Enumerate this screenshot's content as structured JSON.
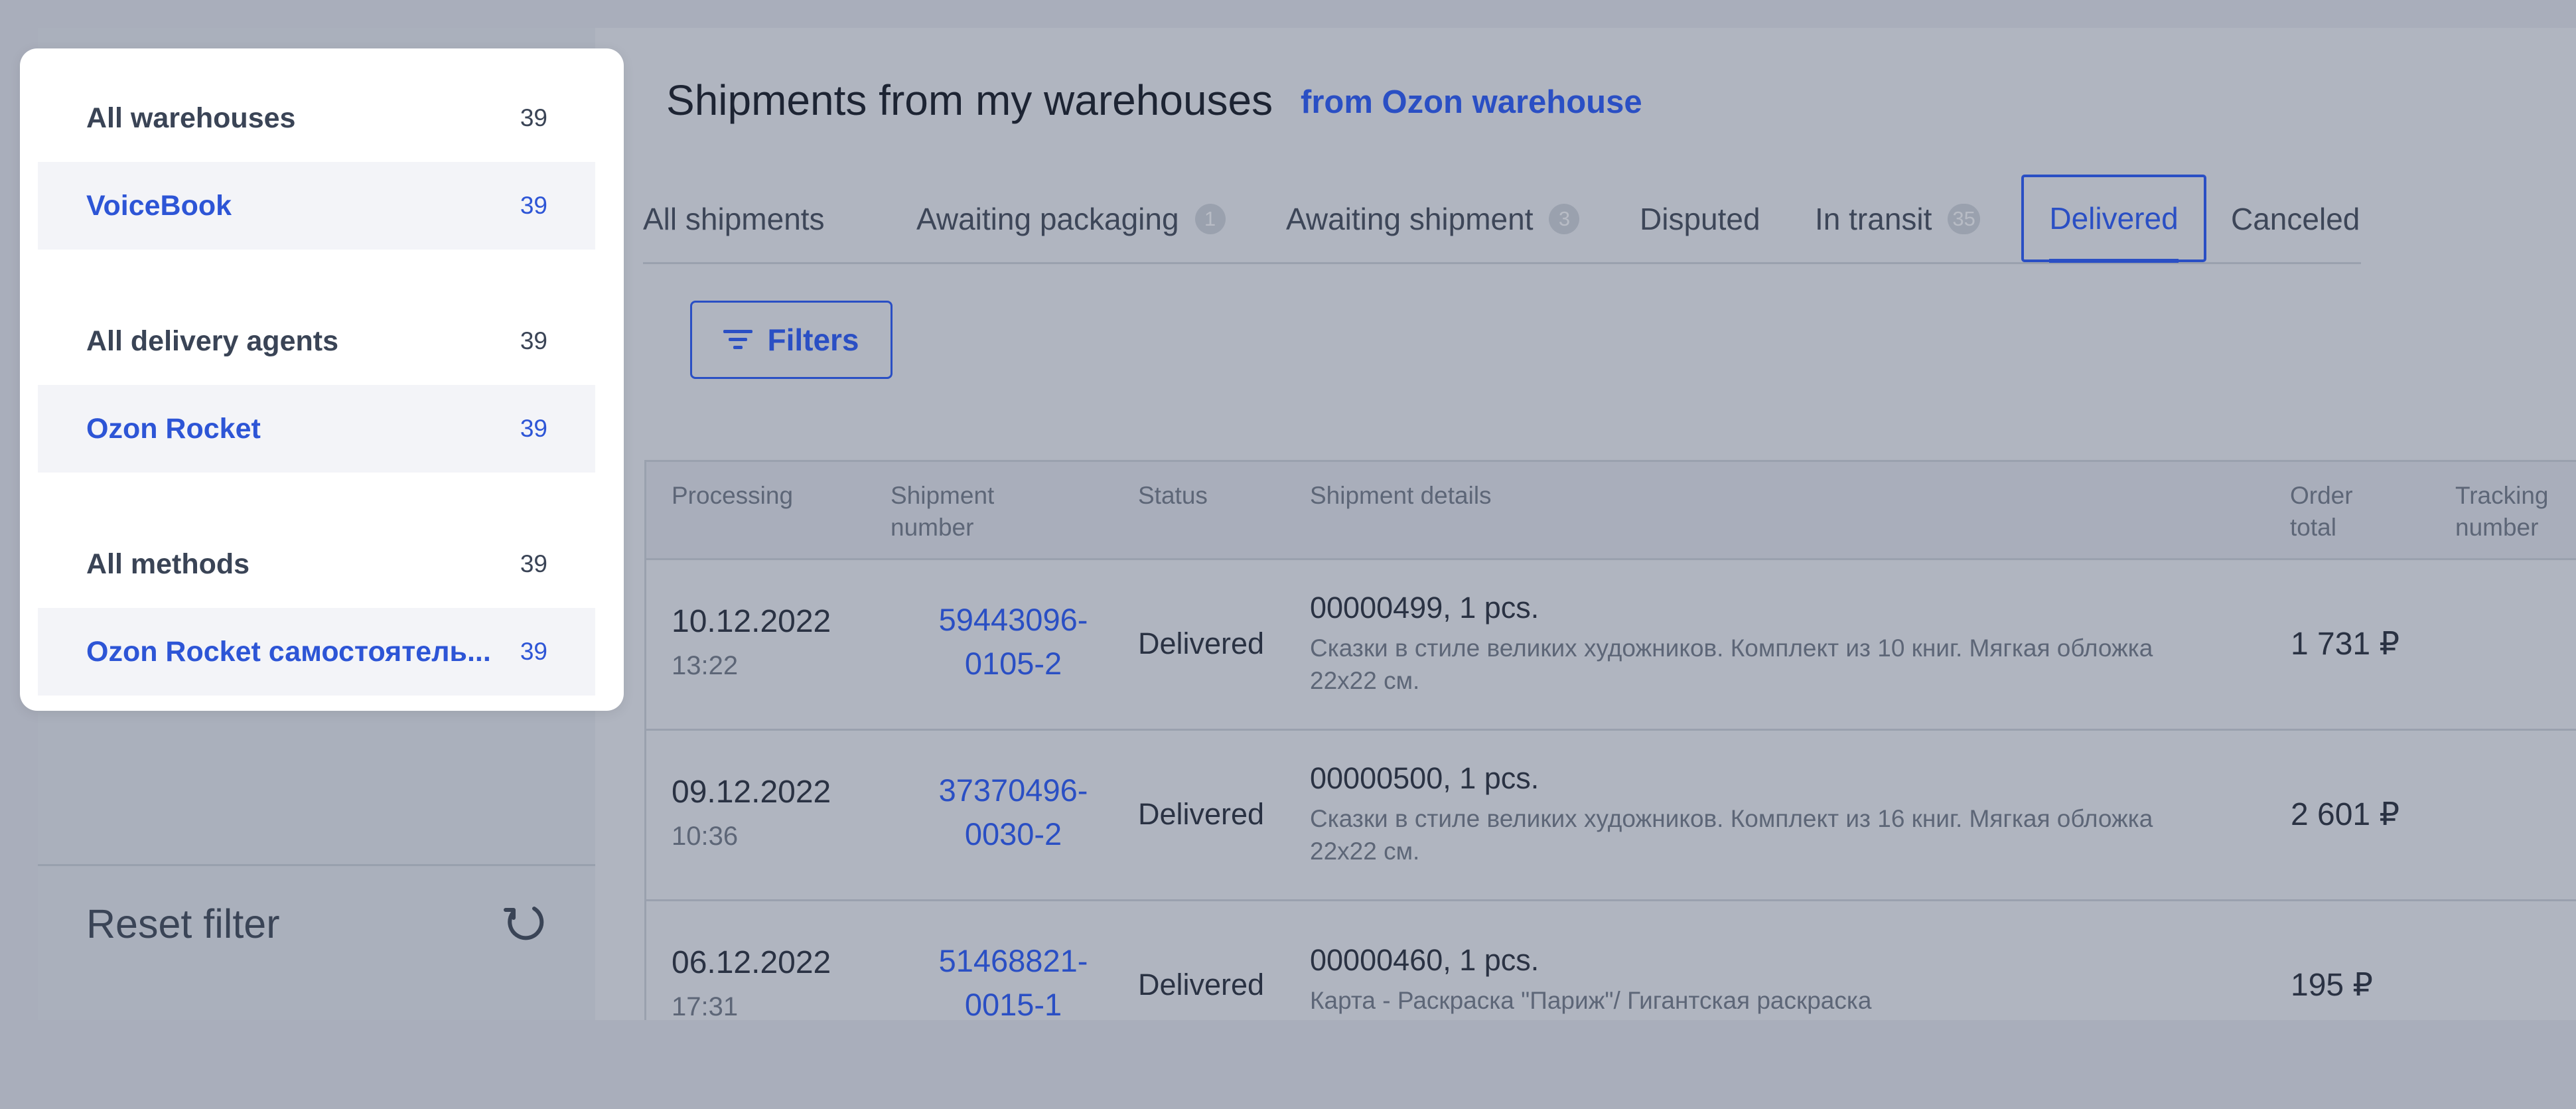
{
  "sidebar": {
    "groups": [
      {
        "head": {
          "label": "All warehouses",
          "count": "39"
        },
        "selected": {
          "label": "VoiceBook",
          "count": "39"
        }
      },
      {
        "head": {
          "label": "All delivery agents",
          "count": "39"
        },
        "selected": {
          "label": "Ozon Rocket",
          "count": "39"
        }
      },
      {
        "head": {
          "label": "All methods",
          "count": "39"
        },
        "selected": {
          "label": "Ozon Rocket самостоятель...",
          "count": "39"
        }
      }
    ],
    "reset_label": "Reset filter"
  },
  "header": {
    "title": "Shipments from my warehouses",
    "link": "from Ozon warehouse"
  },
  "tabs": [
    {
      "label": "All shipments",
      "badge": null
    },
    {
      "label": "Awaiting packaging",
      "badge": "1"
    },
    {
      "label": "Awaiting shipment",
      "badge": "3"
    },
    {
      "label": "Disputed",
      "badge": null
    },
    {
      "label": "In transit",
      "badge": "35"
    },
    {
      "label": "Delivered",
      "badge": null,
      "active": true
    },
    {
      "label": "Canceled",
      "badge": null
    }
  ],
  "filters_label": "Filters",
  "table": {
    "columns": [
      "Processing",
      "Shipment number",
      "Status",
      "Shipment details",
      "Order total",
      "Tracking number"
    ],
    "rows": [
      {
        "date": "10.12.2022",
        "time": "13:22",
        "number": "59443096-0105-2",
        "status": "Delivered",
        "detail_title": "00000499, 1 pcs.",
        "detail_desc": "Сказки в стиле великих художников. Комплект из 10 книг. Мягкая обложка 22х22 см.",
        "total": "1 731 ₽"
      },
      {
        "date": "09.12.2022",
        "time": "10:36",
        "number": "37370496-0030-2",
        "status": "Delivered",
        "detail_title": "00000500, 1 pcs.",
        "detail_desc": "Сказки в стиле великих художников. Комплект из 16 книг. Мягкая обложка 22х22 см.",
        "total": "2 601 ₽"
      },
      {
        "date": "06.12.2022",
        "time": "17:31",
        "number": "51468821-0015-1",
        "status": "Delivered",
        "detail_title": "00000460, 1 pcs.",
        "detail_desc": "Карта - Раскраска \"Париж\"/ Гигантская раскраска",
        "total": "195 ₽"
      }
    ]
  },
  "colors": {
    "accent": "#2a4fc4",
    "overlay": "#b0b5c0",
    "card": "#ffffff"
  },
  "icons": {
    "filters": "filter-lines-icon",
    "reset": "refresh-icon"
  }
}
